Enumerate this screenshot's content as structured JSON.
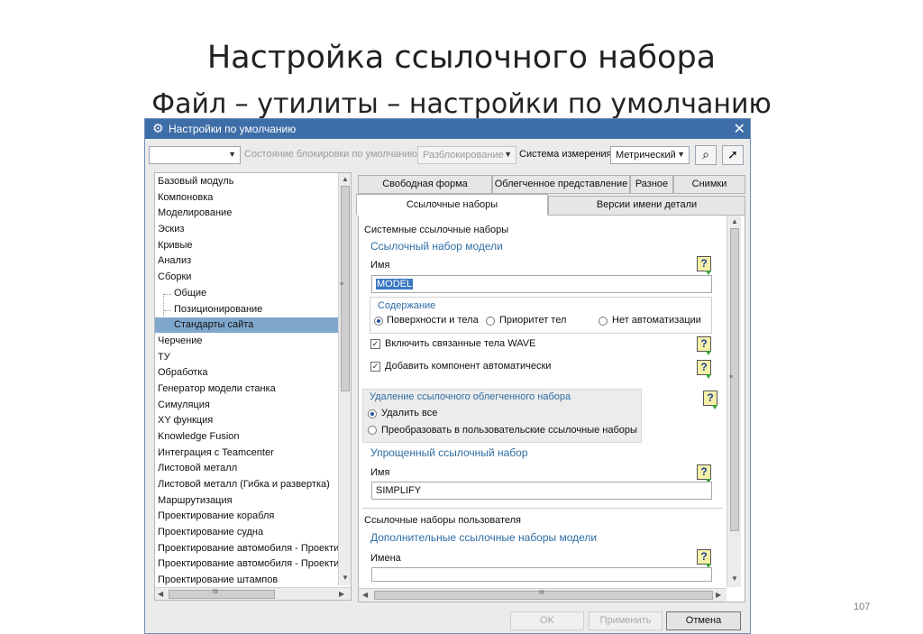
{
  "slide": {
    "title": "Настройка ссылочного набора",
    "subtitle": "Файл – утилиты – настройки по умолчанию",
    "page_number": "107"
  },
  "dialog": {
    "title": "Настройки по умолчанию",
    "toolbar": {
      "lock_state_label": "Состояние блокировки по умолчанию",
      "lock_state_value": "Разблокирование",
      "units_label": "Система измерения",
      "units_value": "Метрический"
    },
    "tree": {
      "items": [
        {
          "label": "Базовый модуль"
        },
        {
          "label": "Компоновка"
        },
        {
          "label": "Моделирование"
        },
        {
          "label": "Эскиз"
        },
        {
          "label": "Кривые"
        },
        {
          "label": "Анализ"
        },
        {
          "label": "Сборки"
        },
        {
          "label": "Общие"
        },
        {
          "label": "Позиционирование"
        },
        {
          "label": "Стандарты сайта"
        },
        {
          "label": "Черчение"
        },
        {
          "label": "ТУ"
        },
        {
          "label": "Обработка"
        },
        {
          "label": "Генератор модели станка"
        },
        {
          "label": "Симуляция"
        },
        {
          "label": "XY функция"
        },
        {
          "label": "Knowledge Fusion"
        },
        {
          "label": "Интеграция с Teamcenter"
        },
        {
          "label": "Листовой металл"
        },
        {
          "label": "Листовой металл (Гибка и развертка)"
        },
        {
          "label": "Маршрутизация"
        },
        {
          "label": "Проектирование корабля"
        },
        {
          "label": "Проектирование судна"
        },
        {
          "label": "Проектирование автомобиля - Проектир"
        },
        {
          "label": "Проектирование автомобиля - Проектир"
        },
        {
          "label": "Проектирование штампов"
        }
      ]
    },
    "tabs_row1": [
      "Свободная форма",
      "Облегченное представление",
      "Разное",
      "Снимки"
    ],
    "tabs_row2": [
      "Ссылочные наборы",
      "Версии имени детали"
    ],
    "panel": {
      "system_sets_heading": "Системные ссылочные наборы",
      "model_set_heading": "Ссылочный набор модели",
      "name_label": "Имя",
      "name_value": "MODEL",
      "content_heading": "Содержание",
      "content_options": [
        "Поверхности и тела",
        "Приоритет тел",
        "Нет автоматизации"
      ],
      "check_wave": "Включить связанные тела WAVE",
      "check_auto_add": "Добавить компонент автоматически",
      "delete_heading": "Удаление ссылочного облегченного набора",
      "delete_options": [
        "Удалить все",
        "Преобразовать в пользовательские ссылочные наборы"
      ],
      "simplified_heading": "Упрощенный ссылочный набор",
      "simplified_name_label": "Имя",
      "simplified_name_value": "SIMPLIFY",
      "user_sets_heading": "Ссылочные наборы пользователя",
      "extra_sets_heading": "Дополнительные ссылочные наборы модели",
      "names_label": "Имена"
    },
    "buttons": {
      "ok": "OK",
      "apply": "Применить",
      "cancel": "Отмена"
    },
    "help_glyph": "?",
    "scroll_grip": "III"
  }
}
